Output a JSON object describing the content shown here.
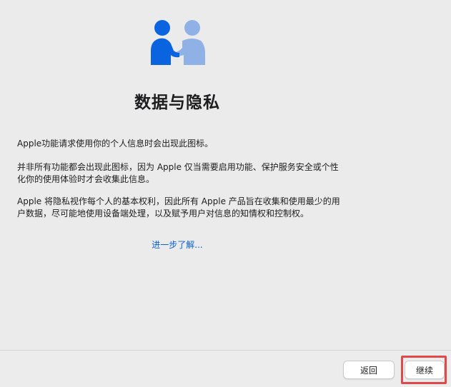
{
  "window": {
    "title": "数据与隐私"
  },
  "icon": {
    "name": "handshake-people-icon",
    "colors": {
      "left_person": "#0a64e0",
      "right_person": "#8fb1e6"
    }
  },
  "content": {
    "paragraph_1": "Apple功能请求使用你的个人信息时会出现此图标。",
    "paragraph_2": "并非所有功能都会出现此图标，因为 Apple 仅当需要启用功能、保护服务安全或个性化你的使用体验时才会收集此信息。",
    "paragraph_3": "Apple 将隐私视作每个人的基本权利，因此所有 Apple 产品旨在收集和使用最少的用户数据，尽可能地使用设备端处理，以及赋予用户对信息的知情权和控制权。",
    "learn_more": "进一步了解..."
  },
  "footer": {
    "back_label": "返回",
    "continue_label": "继续"
  },
  "colors": {
    "link": "#0a60d8",
    "highlight": "#e0484a"
  }
}
